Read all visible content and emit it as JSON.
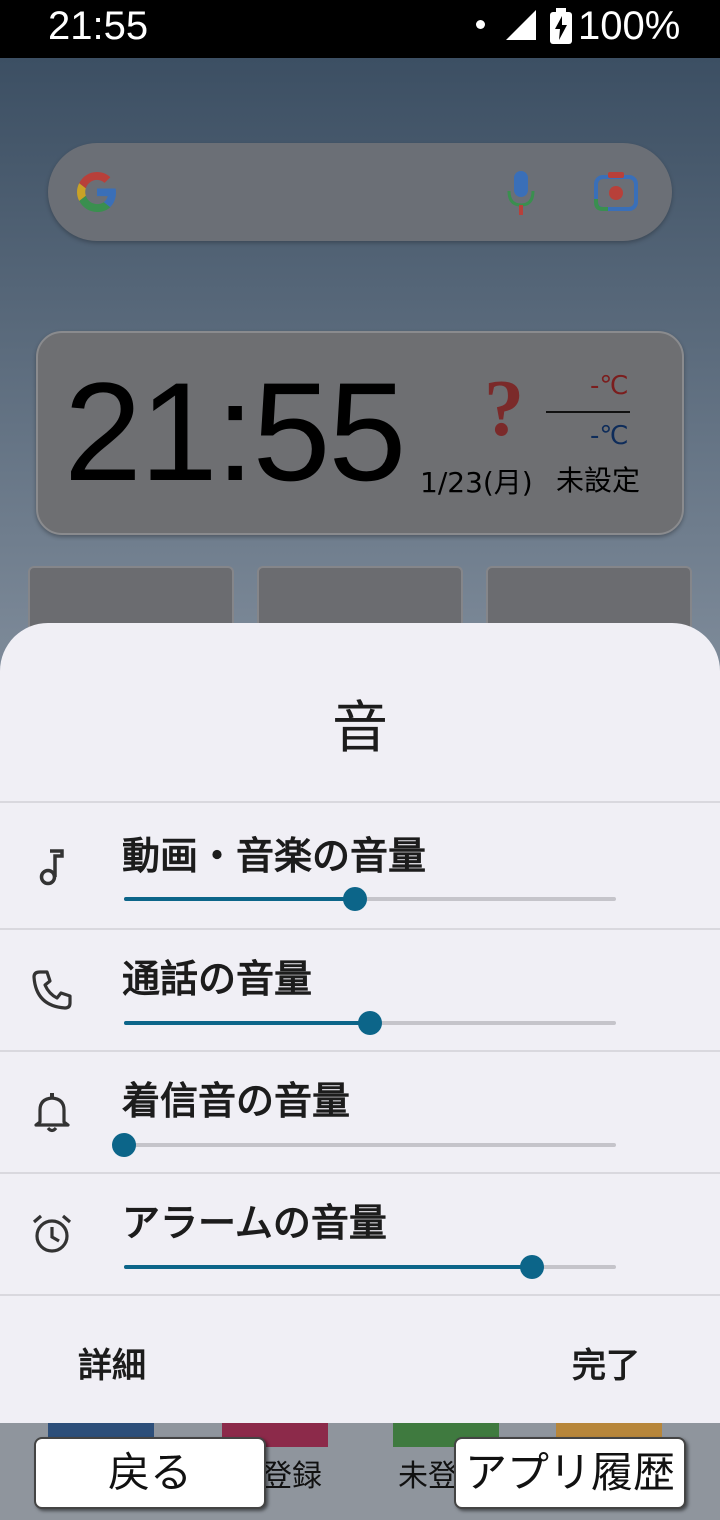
{
  "status_bar": {
    "time": "21:55",
    "battery": "100%"
  },
  "clock_widget": {
    "time": "21:55",
    "weather_icon": "question-mark",
    "temp_high": "-℃",
    "temp_low": "-℃",
    "date": "1/23(月)",
    "location": "未設定"
  },
  "sheet": {
    "title": "音",
    "rows": [
      {
        "label": "動画・音楽の音量",
        "icon": "music-note-icon",
        "value": 0.47
      },
      {
        "label": "通話の音量",
        "icon": "phone-icon",
        "value": 0.5
      },
      {
        "label": "着信音の音量",
        "icon": "bell-icon",
        "value": 0.0
      },
      {
        "label": "アラームの音量",
        "icon": "alarm-icon",
        "value": 0.83
      }
    ],
    "detail_button": "詳細",
    "done_button": "完了"
  },
  "nav": {
    "back": "戻る",
    "recents": "アプリ履歴",
    "dock_label_1": "登録",
    "dock_label_2": "未登"
  },
  "colors": {
    "accent": "#0c6589",
    "sheet_bg": "#f0eff5"
  }
}
